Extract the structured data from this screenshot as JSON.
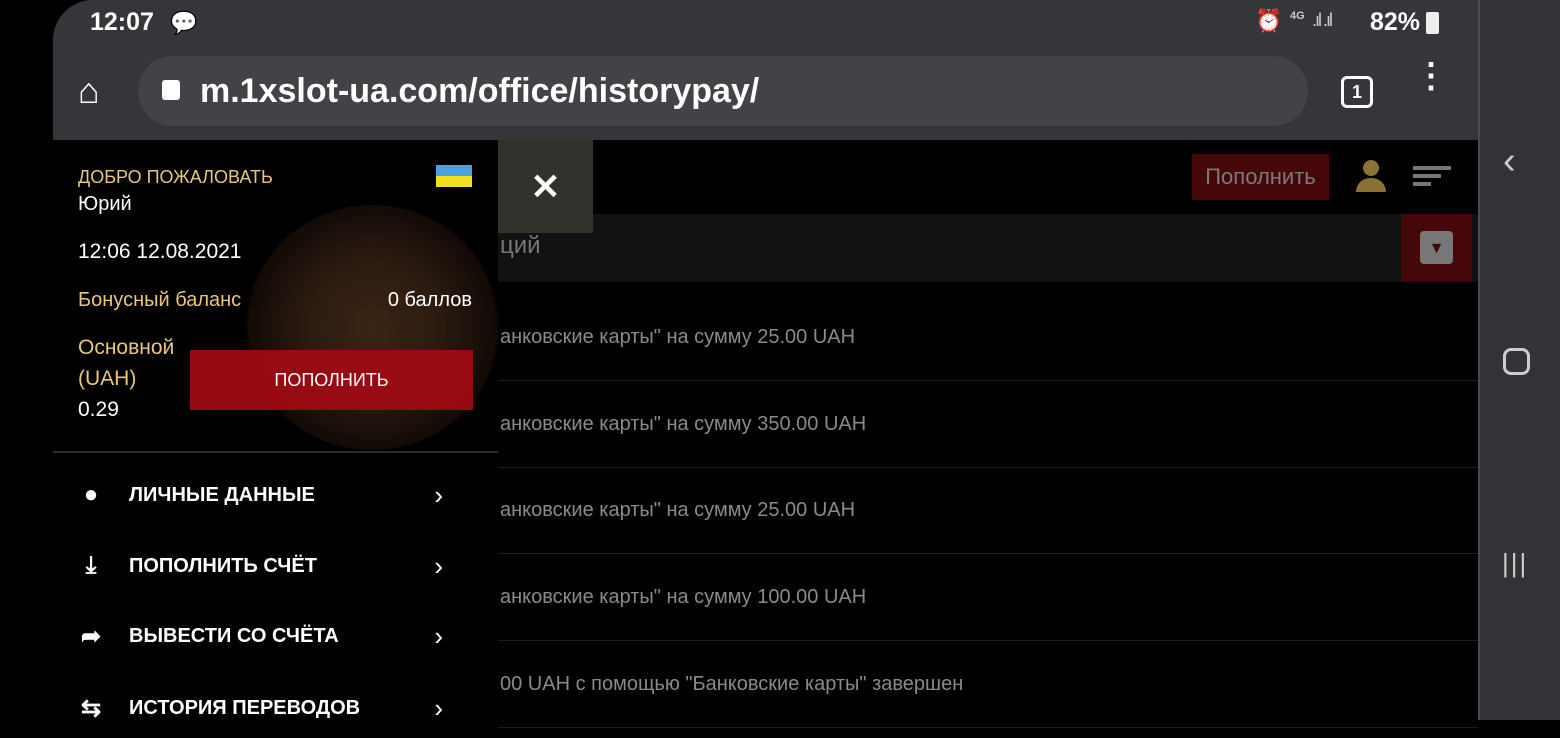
{
  "status_bar": {
    "time": "12:07",
    "network": "4G",
    "battery": "82%"
  },
  "browser": {
    "url": "m.1xslot-ua.com/office/historypay/",
    "tab_count": "1"
  },
  "header": {
    "deposit_label": "Пополнить",
    "section_title_fragment": "ций"
  },
  "drawer": {
    "welcome": "ДОБРО ПОЖАЛОВАТЬ",
    "user_name": "Юрий",
    "datetime": "12:06 12.08.2021",
    "bonus_label": "Бонусный баланс",
    "bonus_value": "0 баллов",
    "main_label_1": "Основной",
    "main_label_2": "(UAH)",
    "main_value": "0.29",
    "deposit_button": "ПОПОЛНИТЬ",
    "menu": [
      {
        "label": "ЛИЧНЫЕ ДАННЫЕ"
      },
      {
        "label": "ПОПОЛНИТЬ СЧЁТ"
      },
      {
        "label": "ВЫВЕСТИ СО СЧЁТА"
      },
      {
        "label": "ИСТОРИЯ ПЕРЕВОДОВ"
      }
    ]
  },
  "history": [
    "анковские карты\" на сумму 25.00 UAH",
    "анковские карты\" на сумму 350.00 UAH",
    "анковские карты\" на сумму 25.00 UAH",
    "анковские карты\" на сумму 100.00 UAH",
    "00 UAH с помощью \"Банковские карты\" завершен"
  ],
  "colors": {
    "accent_red": "#8b0a12",
    "gold": "#e8c878"
  }
}
